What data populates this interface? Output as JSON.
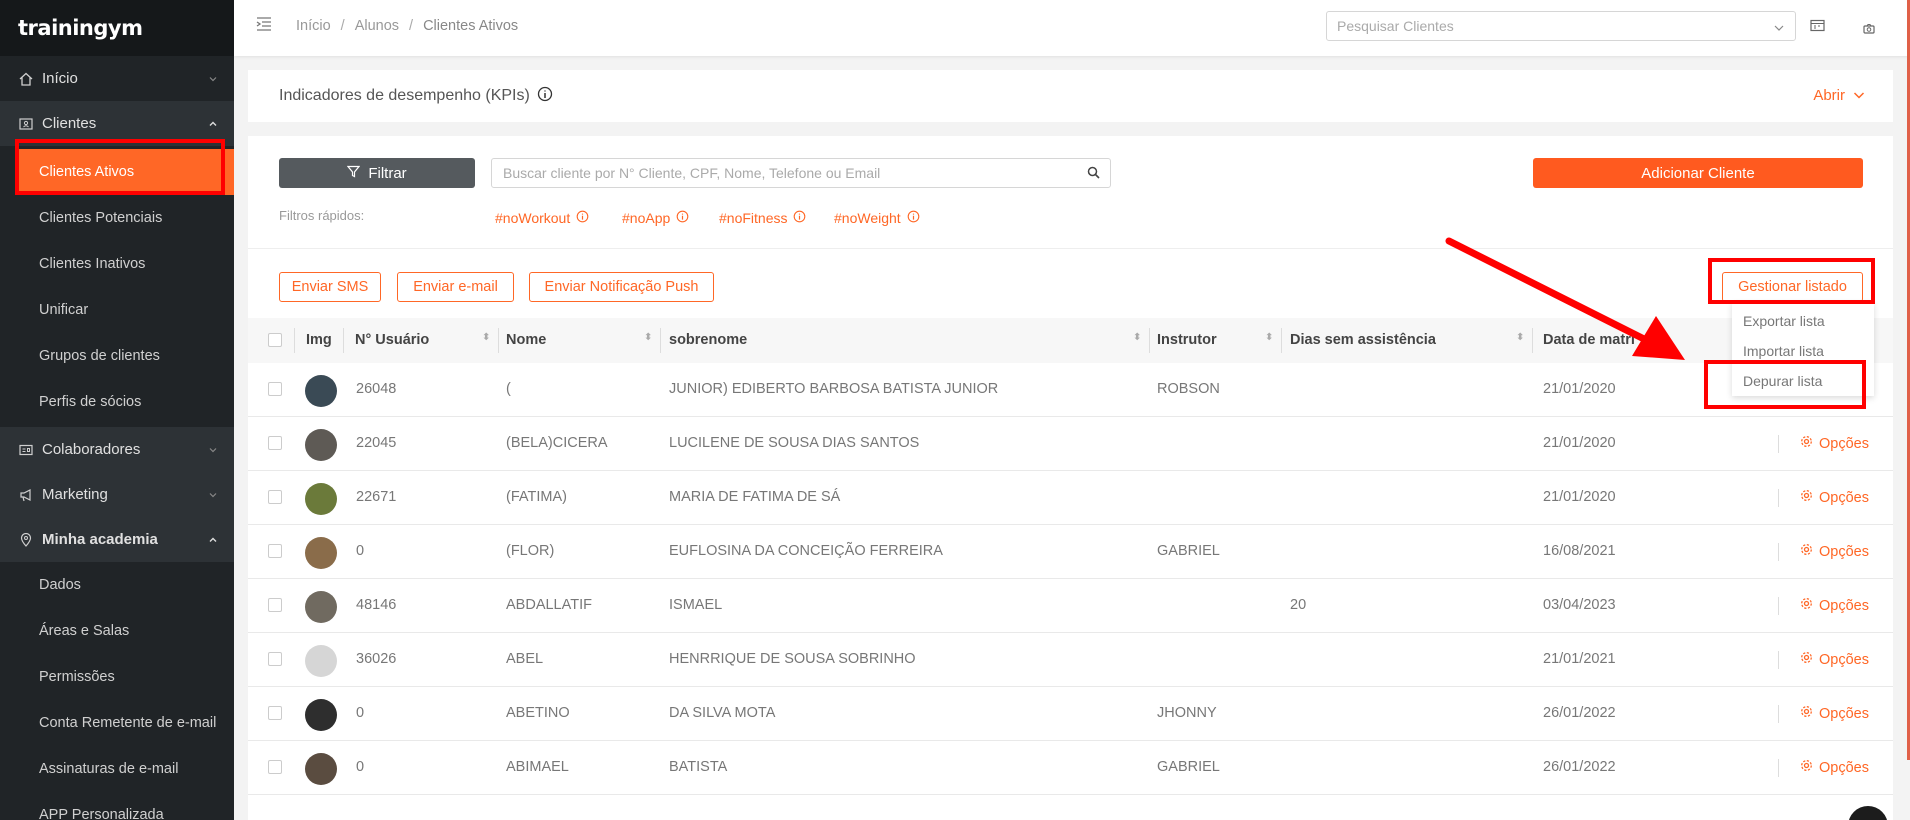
{
  "brand": {
    "logo": "trainingym"
  },
  "sidebar": {
    "sections": [
      {
        "label": "Início"
      },
      {
        "label": "Clientes"
      },
      {
        "label": "Colaboradores"
      },
      {
        "label": "Marketing"
      },
      {
        "label": "Minha academia"
      }
    ],
    "clientes_items": [
      "Clientes Ativos",
      "Clientes Potenciais",
      "Clientes Inativos",
      "Unificar",
      "Grupos de clientes",
      "Perfis de sócios"
    ],
    "academia_items": [
      "Dados",
      "Áreas e Salas",
      "Permissões",
      "Conta Remetente de e-mail",
      "Assinaturas de e-mail",
      "APP Personalizada"
    ]
  },
  "topbar": {
    "breadcrumb": [
      "Início",
      "Alunos",
      "Clientes Ativos"
    ],
    "search_placeholder": "Pesquisar Clientes"
  },
  "kpi": {
    "title": "Indicadores de desempenho (KPIs)",
    "toggle_label": "Abrir"
  },
  "filters": {
    "filter_button": "Filtrar",
    "search_placeholder": "Buscar cliente por N° Cliente, CPF, Nome, Telefone ou Email",
    "add_button": "Adicionar Cliente",
    "quick_label": "Filtros rápidos:",
    "quick_tags": [
      "#noWorkout",
      "#noApp",
      "#noFitness",
      "#noWeight"
    ]
  },
  "actions": {
    "sms": "Enviar SMS",
    "email": "Enviar e-mail",
    "push": "Enviar Notificação Push",
    "manage": "Gestionar listado"
  },
  "manage_menu": [
    "Exportar lista",
    "Importar lista",
    "Depurar lista"
  ],
  "table": {
    "headers": [
      "Img",
      "N° Usuário",
      "Nome",
      "sobrenome",
      "Instrutor",
      "Dias sem assistência",
      "Data de matrí"
    ],
    "options_label": "Opções",
    "rows": [
      {
        "id": "26048",
        "nome": "(",
        "sobrenome": "JUNIOR) EDIBERTO BARBOSA BATISTA JUNIOR",
        "instrutor": "ROBSON",
        "dias": "",
        "data": "21/01/2020"
      },
      {
        "id": "22045",
        "nome": "(BELA)CICERA",
        "sobrenome": "LUCILENE DE SOUSA DIAS SANTOS",
        "instrutor": "",
        "dias": "",
        "data": "21/01/2020"
      },
      {
        "id": "22671",
        "nome": "(FATIMA)",
        "sobrenome": "MARIA DE FATIMA DE SÁ",
        "instrutor": "",
        "dias": "",
        "data": "21/01/2020"
      },
      {
        "id": "0",
        "nome": "(FLOR)",
        "sobrenome": "EUFLOSINA DA CONCEIÇÃO FERREIRA",
        "instrutor": "GABRIEL",
        "dias": "",
        "data": "16/08/2021"
      },
      {
        "id": "48146",
        "nome": "ABDALLATIF",
        "sobrenome": "ISMAEL",
        "instrutor": "",
        "dias": "20",
        "data": "03/04/2023"
      },
      {
        "id": "36026",
        "nome": "ABEL",
        "sobrenome": "HENRRIQUE DE SOUSA SOBRINHO",
        "instrutor": "",
        "dias": "",
        "data": "21/01/2021"
      },
      {
        "id": "0",
        "nome": "ABETINO",
        "sobrenome": "DA SILVA MOTA",
        "instrutor": "JHONNY",
        "dias": "",
        "data": "26/01/2022"
      },
      {
        "id": "0",
        "nome": "ABIMAEL",
        "sobrenome": "BATISTA",
        "instrutor": "GABRIEL",
        "dias": "",
        "data": "26/01/2022"
      }
    ]
  },
  "colors": {
    "accent": "#ff6726",
    "sidebar": "#202427",
    "annotation": "#ff0000"
  }
}
